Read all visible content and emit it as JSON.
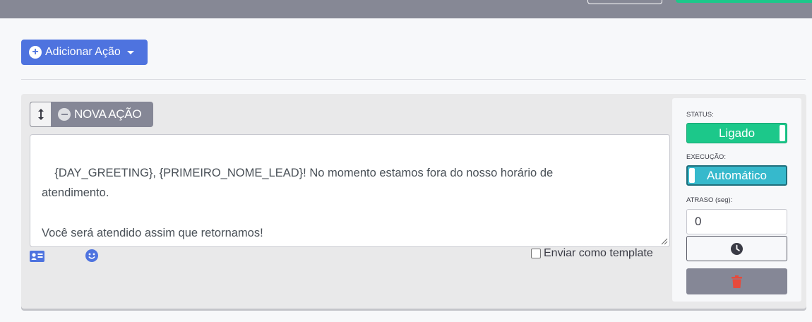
{
  "toolbar": {
    "add_action_label": "Adicionar Ação",
    "add_action_icon": "plus-circle-icon",
    "accent_color": "#4e73df"
  },
  "action": {
    "title": "NOVA AÇÃO",
    "message": "{DAY_GREETING}, {PRIMEIRO_NOME_LEAD}! No momento estamos fora do nosso horário de\natendimento.\n\nVocê será atendido assim que retornamos!",
    "send_as_template_label": "Enviar como template",
    "send_as_template_checked": false,
    "icons": [
      "arrows-vertical-icon",
      "minus-circle-icon",
      "contact-card-icon",
      "smile-icon"
    ]
  },
  "settings": {
    "status_label": "STATUS:",
    "status_value": "Ligado",
    "status_color": "#1cc88a",
    "execution_label": "EXECUÇÃO:",
    "execution_value": "Automático",
    "execution_color": "#36b9cc",
    "delay_label": "ATRASO (seg):",
    "delay_value": "0",
    "schedule_icon": "clock-icon",
    "delete_icon": "trash-icon",
    "delete_color": "#e74a3b"
  }
}
